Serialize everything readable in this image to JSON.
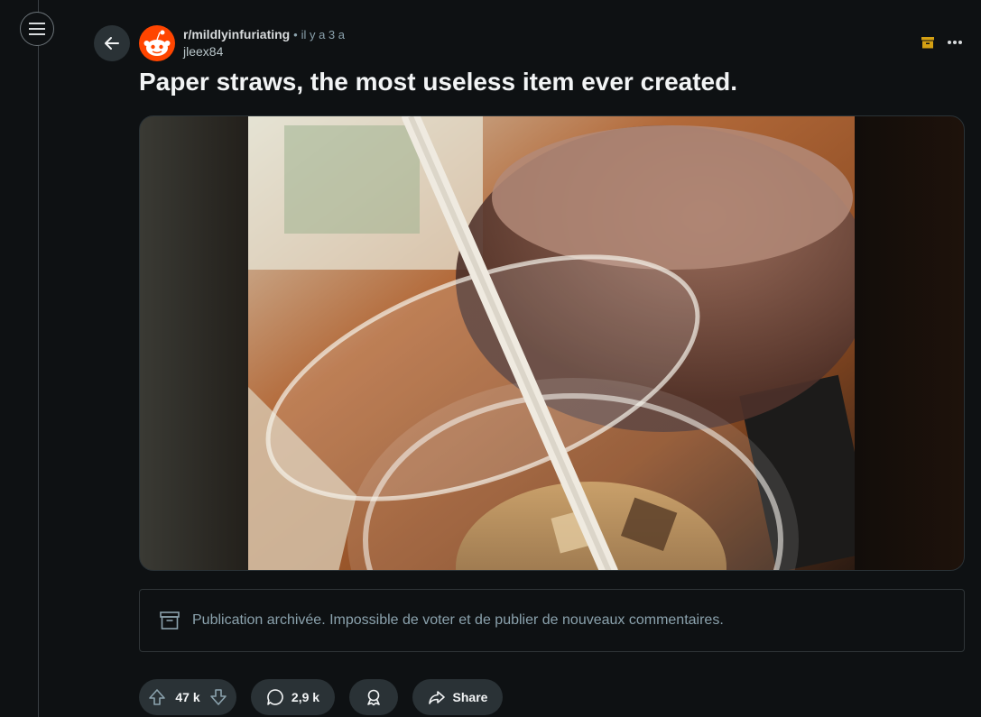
{
  "post": {
    "subreddit": "r/mildlyinfuriating",
    "separator": "•",
    "age": "il y a 3 a",
    "author": "jleex84",
    "title": "Paper straws, the most useless item ever created."
  },
  "archived_notice": "Publication archivée. Impossible de voter et de publier de nouveaux commentaires.",
  "actions": {
    "votes": "47 k",
    "comments": "2,9 k",
    "share": "Share"
  },
  "icons": {
    "menu": "menu-icon",
    "back": "arrow-left-icon",
    "archive_badge": "archive-icon",
    "more": "more-horizontal-icon",
    "upvote": "upvote-icon",
    "downvote": "downvote-icon",
    "comment": "comment-icon",
    "award": "award-icon",
    "share": "share-icon"
  },
  "colors": {
    "background": "#0e1113",
    "pill": "#2a3236",
    "accent_archive": "#d4a013",
    "avatar": "#ff4500"
  }
}
